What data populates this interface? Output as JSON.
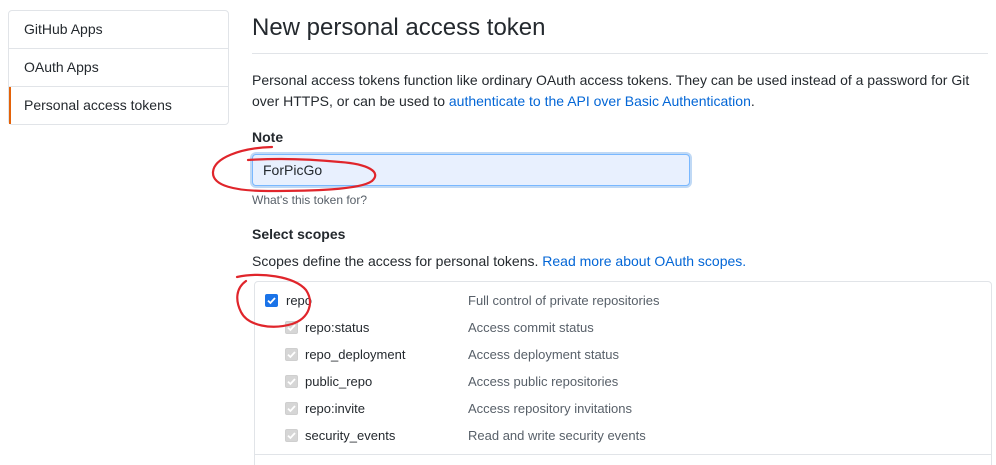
{
  "sidebar": {
    "items": [
      {
        "label": "GitHub Apps"
      },
      {
        "label": "OAuth Apps"
      },
      {
        "label": "Personal access tokens"
      }
    ]
  },
  "main": {
    "title": "New personal access token",
    "description_text": "Personal access tokens function like ordinary OAuth access tokens. They can be used instead of a password for Git over HTTPS, or can be used to ",
    "description_link": "authenticate to the API over Basic Authentication",
    "description_end": ".",
    "note": {
      "label": "Note",
      "value": "ForPicGo",
      "hint": "What's this token for?"
    },
    "scopes": {
      "heading": "Select scopes",
      "desc_text": "Scopes define the access for personal tokens. ",
      "desc_link": "Read more about OAuth scopes.",
      "items": [
        {
          "name": "repo",
          "description": "Full control of private repositories",
          "checked": true
        },
        {
          "name": "repo:status",
          "description": "Access commit status",
          "checked": true
        },
        {
          "name": "repo_deployment",
          "description": "Access deployment status",
          "checked": true
        },
        {
          "name": "public_repo",
          "description": "Access public repositories",
          "checked": true
        },
        {
          "name": "repo:invite",
          "description": "Access repository invitations",
          "checked": true
        },
        {
          "name": "security_events",
          "description": "Read and write security events",
          "checked": true
        }
      ]
    }
  },
  "colors": {
    "link": "#0366d6",
    "selected_accent": "#e36209",
    "checkbox": "#1a73e8",
    "annotation": "#e0252b"
  }
}
